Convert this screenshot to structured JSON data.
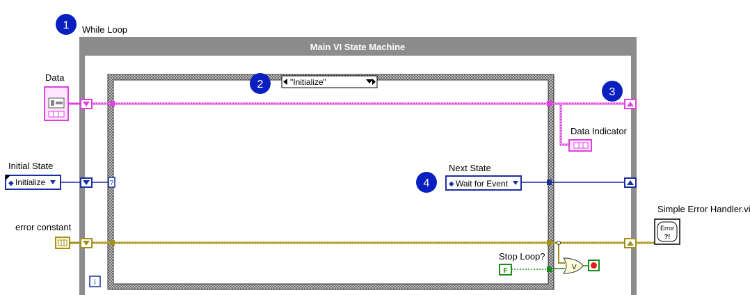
{
  "while_loop": {
    "label": "While Loop",
    "title": "Main VI State Machine",
    "iteration_terminal": "i"
  },
  "badges": [
    "1",
    "2",
    "3",
    "4"
  ],
  "case_structure": {
    "selector": "\"Initialize\"",
    "selector_terminal": "?"
  },
  "controls": {
    "data": {
      "label": "Data"
    },
    "initial_state": {
      "label": "Initial State",
      "value": "Initialize"
    },
    "error_constant": {
      "label": "error constant"
    }
  },
  "indicators": {
    "data_indicator": {
      "label": "Data Indicator"
    },
    "next_state": {
      "label": "Next State",
      "value": "Wait for Event"
    },
    "stop_loop": {
      "label": "Stop Loop?",
      "constant": "F"
    }
  },
  "subvi": {
    "label": "Simple Error Handler.vi",
    "icon_text_top": "Error",
    "icon_text_bottom": "?!"
  },
  "colors": {
    "wire_cluster": "#e040e0",
    "wire_enum": "#1a2fa0",
    "wire_error": "#a09020",
    "wire_bool": "#1a8a1a",
    "loop_frame": "#8c8c8c",
    "badge": "#0a1fc0"
  }
}
